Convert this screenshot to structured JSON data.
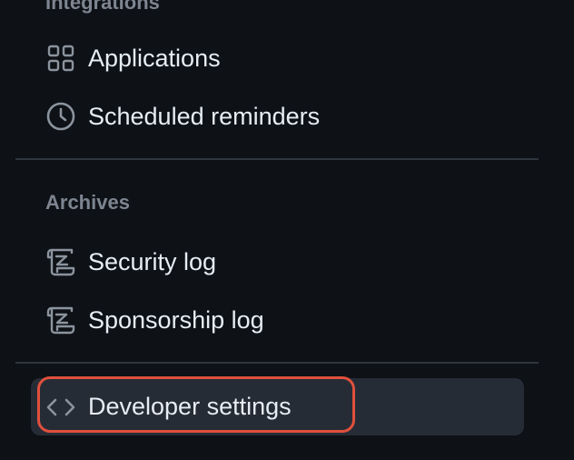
{
  "sections": {
    "integrations": {
      "heading": "Integrations",
      "items": [
        {
          "label": "Applications",
          "icon": "apps-grid-icon"
        },
        {
          "label": "Scheduled reminders",
          "icon": "clock-icon"
        }
      ]
    },
    "archives": {
      "heading": "Archives",
      "items": [
        {
          "label": "Security log",
          "icon": "log-icon"
        },
        {
          "label": "Sponsorship log",
          "icon": "log-icon"
        }
      ]
    },
    "developer": {
      "items": [
        {
          "label": "Developer settings",
          "icon": "code-icon",
          "active": true
        }
      ]
    }
  },
  "colors": {
    "background": "#0e1116",
    "text": "#e6edf3",
    "muted": "#7d8590",
    "divider": "#30363d",
    "active_bg": "#262c36",
    "highlight": "#e0503d"
  }
}
